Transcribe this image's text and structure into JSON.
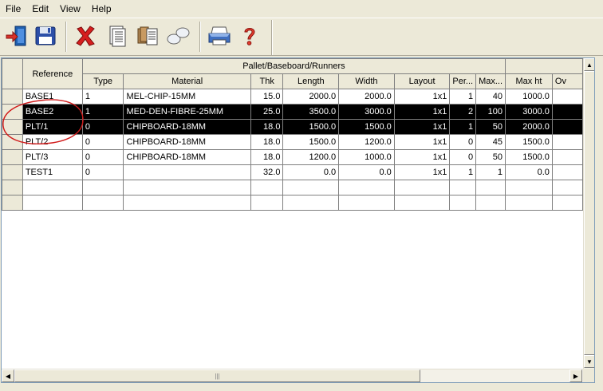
{
  "menu": {
    "file": "File",
    "edit": "Edit",
    "view": "View",
    "help": "Help"
  },
  "toolbar": {
    "buttons": [
      {
        "icon": "exit-door-icon"
      },
      {
        "icon": "save-disk-icon"
      },
      {
        "icon": "delete-x-icon"
      },
      {
        "icon": "document-list-icon"
      },
      {
        "icon": "copy-records-icon"
      },
      {
        "icon": "link-ovals-icon"
      },
      {
        "icon": "printer-icon"
      },
      {
        "icon": "help-question-icon"
      }
    ]
  },
  "grid": {
    "group_header": "Pallet/Baseboard/Runners",
    "columns": {
      "reference": "Reference",
      "type": "Type",
      "material": "Material",
      "thk": "Thk",
      "length": "Length",
      "width": "Width",
      "layout": "Layout",
      "per": "Per...",
      "max": "Max...",
      "max_ht": "Max ht",
      "ov": "Ov"
    },
    "rows": [
      {
        "reference": "BASE1",
        "type": "1",
        "material": "MEL-CHIP-15MM",
        "thk": "15.0",
        "length": "2000.0",
        "width": "2000.0",
        "layout": "1x1",
        "per": "1",
        "max": "40",
        "max_ht": "1000.0",
        "selected": false
      },
      {
        "reference": "BASE2",
        "type": "1",
        "material": "MED-DEN-FIBRE-25MM",
        "thk": "25.0",
        "length": "3500.0",
        "width": "3000.0",
        "layout": "1x1",
        "per": "2",
        "max": "100",
        "max_ht": "3000.0",
        "selected": true
      },
      {
        "reference": "PLT/1",
        "type": "0",
        "material": "CHIPBOARD-18MM",
        "thk": "18.0",
        "length": "1500.0",
        "width": "1500.0",
        "layout": "1x1",
        "per": "1",
        "max": "50",
        "max_ht": "2000.0",
        "selected": true
      },
      {
        "reference": "PLT/2",
        "type": "0",
        "material": "CHIPBOARD-18MM",
        "thk": "18.0",
        "length": "1500.0",
        "width": "1200.0",
        "layout": "1x1",
        "per": "0",
        "max": "45",
        "max_ht": "1500.0",
        "selected": false
      },
      {
        "reference": "PLT/3",
        "type": "0",
        "material": "CHIPBOARD-18MM",
        "thk": "18.0",
        "length": "1200.0",
        "width": "1000.0",
        "layout": "1x1",
        "per": "0",
        "max": "50",
        "max_ht": "1500.0",
        "selected": false
      },
      {
        "reference": "TEST1",
        "type": "0",
        "material": "",
        "thk": "32.0",
        "length": "0.0",
        "width": "0.0",
        "layout": "1x1",
        "per": "1",
        "max": "1",
        "max_ht": "0.0",
        "selected": false
      }
    ]
  },
  "colors": {
    "selection_bg": "#000000",
    "selection_fg": "#ffffff",
    "annotation": "#d11a1a"
  }
}
